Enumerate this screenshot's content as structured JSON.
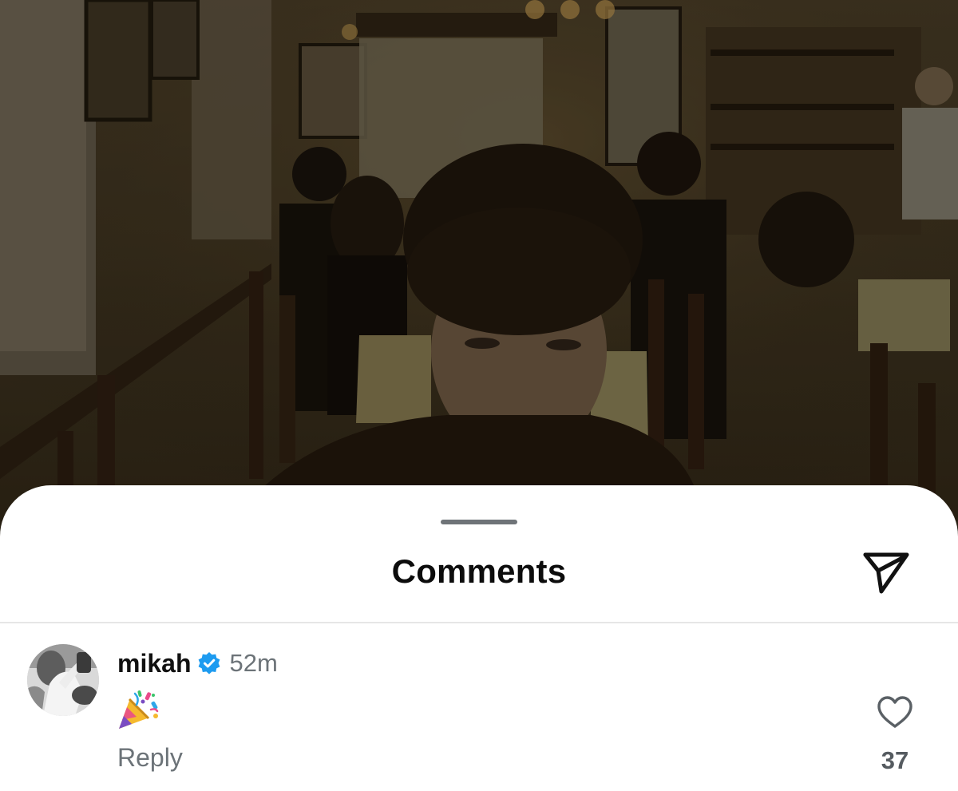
{
  "sheet": {
    "title": "Comments"
  },
  "icons": {
    "share": "send-paper-plane-icon",
    "like": "heart-outline-icon",
    "verified": "verified-badge-icon",
    "grabber": "sheet-grabber"
  },
  "colors": {
    "verified_blue": "#1d9bf0",
    "secondary_text": "#6c7378",
    "primary_text": "#111111"
  },
  "comments": [
    {
      "username": "mikah",
      "verified": true,
      "time": "52m",
      "text_emoji": "party-popper",
      "reply_label": "Reply",
      "like_count": "37"
    }
  ]
}
